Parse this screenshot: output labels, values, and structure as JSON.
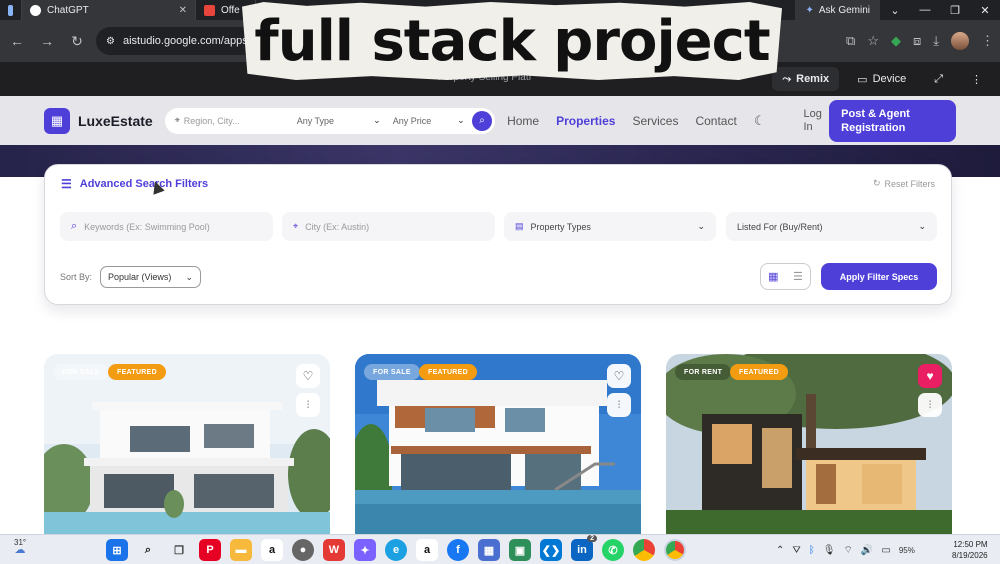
{
  "browser": {
    "tabs": [
      {
        "label": "",
        "favicon_color": "#8ab4f8"
      },
      {
        "label": "ChatGPT",
        "favicon_color": "#ffffff"
      },
      {
        "label": "Offe",
        "favicon_color": "#e8453c"
      }
    ],
    "gemini_label": "Ask Gemini",
    "url": "aistudio.google.com/apps/d3"
  },
  "overlay_caption": "full stack project",
  "aistudio": {
    "subtitle": "Property Selling Platf",
    "remix_label": "Remix",
    "device_label": "Device"
  },
  "site": {
    "logo_text": "LuxeEstate",
    "search": {
      "region_placeholder": "Region, City...",
      "type_value": "Any Type",
      "price_value": "Any Price"
    },
    "nav": {
      "home": "Home",
      "properties": "Properties",
      "services": "Services",
      "contact": "Contact"
    },
    "login_label": "Log In",
    "cta_label": "Post & Agent Registration",
    "accent_color": "#4f3fd9"
  },
  "filters": {
    "title": "Advanced Search Filters",
    "reset_label": "Reset Filters",
    "keywords_placeholder": "Keywords (Ex: Swimming Pool)",
    "city_placeholder": "City (Ex: Austin)",
    "property_types": "Property Types",
    "listed_for": "Listed For (Buy/Rent)",
    "sort_label": "Sort By:",
    "sort_value": "Popular (Views)",
    "apply_label": "Apply Filter Specs"
  },
  "listings": [
    {
      "status": "FOR SALE",
      "tag": "FEATURED",
      "liked": false
    },
    {
      "status": "FOR SALE",
      "tag": "FEATURED",
      "liked": false
    },
    {
      "status": "FOR RENT",
      "tag": "FEATURED",
      "liked": true
    }
  ],
  "taskbar": {
    "weather": "31°",
    "linkedin_badge": "2",
    "battery": "95%",
    "time": "12:50 PM",
    "date": "8/19/2026"
  }
}
